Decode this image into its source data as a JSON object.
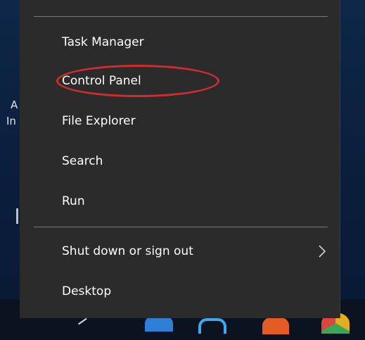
{
  "desktop": {
    "partial_text_1": "A",
    "partial_text_2": "In"
  },
  "menu": {
    "items": [
      {
        "label": "Task Manager"
      },
      {
        "label": "Control Panel",
        "annotation": "circled"
      },
      {
        "label": "File Explorer"
      },
      {
        "label": "Search"
      },
      {
        "label": "Run"
      },
      {
        "label": "Shut down or sign out",
        "has_submenu": true
      },
      {
        "label": "Desktop"
      }
    ]
  },
  "colors": {
    "menu_background": "#2b2b2b",
    "menu_text": "#ffffff",
    "highlight_ellipse": "#d42c2c",
    "taskbar": "#0b1220"
  },
  "icons": [
    "chevron-right-icon",
    "windows-logo-icon",
    "edge-icon",
    "store-icon",
    "firefox-icon",
    "chrome-icon"
  ]
}
